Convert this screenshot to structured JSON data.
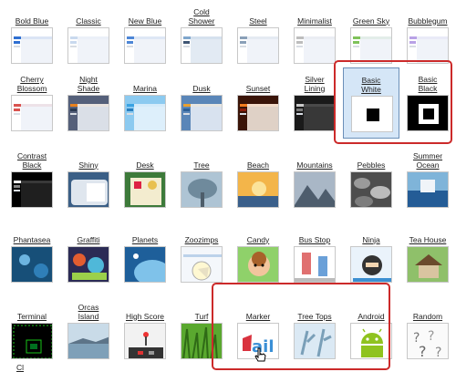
{
  "rows": [
    [
      {
        "label": "Bold Blue",
        "icon": "bold-blue-theme-thumbnail",
        "accent": "#2f6fd1"
      },
      {
        "label": "Classic",
        "icon": "classic-theme-thumbnail",
        "accent": "#c9d9ee"
      },
      {
        "label": "New Blue",
        "icon": "new-blue-theme-thumbnail",
        "accent": "#4d86d6"
      },
      {
        "label": "Cold\nShower",
        "icon": "cold-shower-theme-thumbnail",
        "accent": "#5b6b82"
      },
      {
        "label": "Steel",
        "icon": "steel-theme-thumbnail",
        "accent": "#8aa0b8"
      },
      {
        "label": "Minimalist",
        "icon": "minimalist-theme-thumbnail",
        "accent": "#bdbdbd"
      },
      {
        "label": "Green Sky",
        "icon": "green-sky-theme-thumbnail",
        "accent": "#7fc25a"
      },
      {
        "label": "Bubblegum",
        "icon": "bubblegum-theme-thumbnail",
        "accent": "#b9a2e6"
      }
    ],
    [
      {
        "label": "Cherry\nBlossom",
        "icon": "cherry-blossom-theme-thumbnail",
        "accent": "#d9534f"
      },
      {
        "label": "Night\nShade",
        "icon": "night-shade-theme-thumbnail",
        "accent": "#e8821f"
      },
      {
        "label": "Marina",
        "icon": "marina-theme-thumbnail",
        "accent": "#3aa3e3"
      },
      {
        "label": "Dusk",
        "icon": "dusk-theme-thumbnail",
        "accent": "#3b7fc4"
      },
      {
        "label": "Sunset",
        "icon": "sunset-theme-thumbnail",
        "accent": "#d8511c"
      },
      {
        "label": "Silver\nLining",
        "icon": "silver-lining-theme-thumbnail",
        "accent": "#7a7a7a"
      },
      {
        "label": "Basic\nWhite",
        "icon": "basic-white-theme-thumbnail",
        "accent": "#ffffff"
      },
      {
        "label": "Basic\nBlack",
        "icon": "basic-black-theme-thumbnail",
        "accent": "#000000"
      }
    ],
    [
      {
        "label": "Contrast\nBlack",
        "icon": "contrast-black-theme-thumbnail",
        "accent": "#111111"
      },
      {
        "label": "Shiny",
        "icon": "shiny-theme-thumbnail",
        "accent": "#9aa4ad"
      },
      {
        "label": "Desk",
        "icon": "desk-theme-thumbnail",
        "accent": "#3d7a3a"
      },
      {
        "label": "Tree",
        "icon": "tree-theme-thumbnail",
        "accent": "#7f9db5"
      },
      {
        "label": "Beach",
        "icon": "beach-theme-thumbnail",
        "accent": "#e8a83a"
      },
      {
        "label": "Mountains",
        "icon": "mountains-theme-thumbnail",
        "accent": "#5e6e80"
      },
      {
        "label": "Pebbles",
        "icon": "pebbles-theme-thumbnail",
        "accent": "#6b6b6b"
      },
      {
        "label": "Summer\nOcean",
        "icon": "summer-ocean-theme-thumbnail",
        "accent": "#2b6aa8"
      }
    ],
    [
      {
        "label": "Phantasea",
        "icon": "phantasea-theme-thumbnail",
        "accent": "#1e5f8a"
      },
      {
        "label": "Graffiti",
        "icon": "graffiti-theme-thumbnail",
        "accent": "#4a4a8a"
      },
      {
        "label": "Planets",
        "icon": "planets-theme-thumbnail",
        "accent": "#2a7ab8"
      },
      {
        "label": "Zoozimps",
        "icon": "zoozimps-theme-thumbnail",
        "accent": "#c9dcef"
      },
      {
        "label": "Candy",
        "icon": "candy-theme-thumbnail",
        "accent": "#78c24a"
      },
      {
        "label": "Bus Stop",
        "icon": "bus-stop-theme-thumbnail",
        "accent": "#e06060"
      },
      {
        "label": "Ninja",
        "icon": "ninja-theme-thumbnail",
        "accent": "#3b8fd1"
      },
      {
        "label": "Tea House",
        "icon": "tea-house-theme-thumbnail",
        "accent": "#5d8b3a"
      }
    ],
    [
      {
        "label": "Terminal",
        "icon": "terminal-theme-thumbnail",
        "accent": "#19c419"
      },
      {
        "label": "Orcas\nIsland",
        "icon": "orcas-island-theme-thumbnail",
        "accent": "#8eb0c8"
      },
      {
        "label": "High Score",
        "icon": "high-score-theme-thumbnail",
        "accent": "#333333"
      },
      {
        "label": "Turf",
        "icon": "turf-theme-thumbnail",
        "accent": "#4f9a2a"
      },
      {
        "label": "Marker",
        "icon": "marker-theme-thumbnail",
        "accent": "#d9333f"
      },
      {
        "label": "Tree Tops",
        "icon": "tree-tops-theme-thumbnail",
        "accent": "#a9c9e0"
      },
      {
        "label": "Android",
        "icon": "android-theme-thumbnail",
        "accent": "#8fc31f"
      },
      {
        "label": "Random",
        "icon": "random-theme-thumbnail",
        "accent": "#888888"
      }
    ]
  ],
  "selected_theme": "Basic White",
  "marker_wordmark": "ail",
  "random_glyph": "?",
  "truncated_next_label": "Cl",
  "colors": {
    "highlight": "#cc2a2a",
    "selected_bg": "#d5e6f7"
  }
}
